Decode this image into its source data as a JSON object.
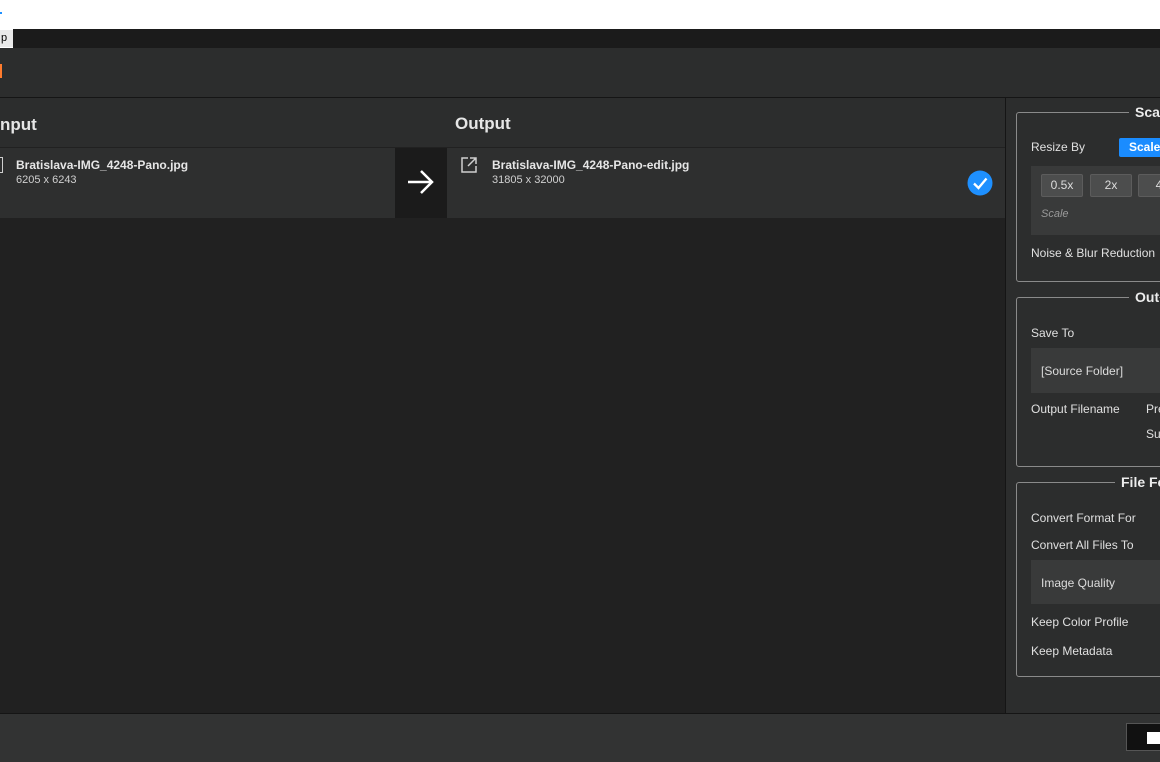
{
  "window": {
    "tiny_tab_label": "p"
  },
  "columns": {
    "input_title": "nput",
    "output_title": "Output"
  },
  "files": [
    {
      "input_name": "Bratislava-IMG_4248-Pano.jpg",
      "input_dims": "6205 x 6243",
      "output_name": "Bratislava-IMG_4248-Pano-edit.jpg",
      "output_dims": "31805 x 32000",
      "status": "done"
    }
  ],
  "scale_panel": {
    "title": "Sca",
    "resize_by_label": "Resize By",
    "mode_button": "Scale",
    "scale_chips": [
      "0.5x",
      "2x",
      "4"
    ],
    "scale_placeholder": "Scale",
    "noise_label": "Noise & Blur Reduction"
  },
  "output_panel": {
    "title": "Out",
    "save_to_label": "Save To",
    "save_to_value": "[Source Folder]",
    "output_filename_label": "Output Filename",
    "prefix_label": "Pre",
    "suffix_label": "Suf"
  },
  "file_format_panel": {
    "title": "File Fo",
    "convert_for_label": "Convert Format For",
    "convert_all_label": "Convert All Files To",
    "image_quality_label": "Image Quality",
    "keep_color_profile_label": "Keep Color Profile",
    "keep_metadata_label": "Keep Metadata"
  },
  "colors": {
    "accent": "#1a8cff",
    "check": "#1e90ff",
    "toolbar_accent": "#ff7b2d"
  }
}
